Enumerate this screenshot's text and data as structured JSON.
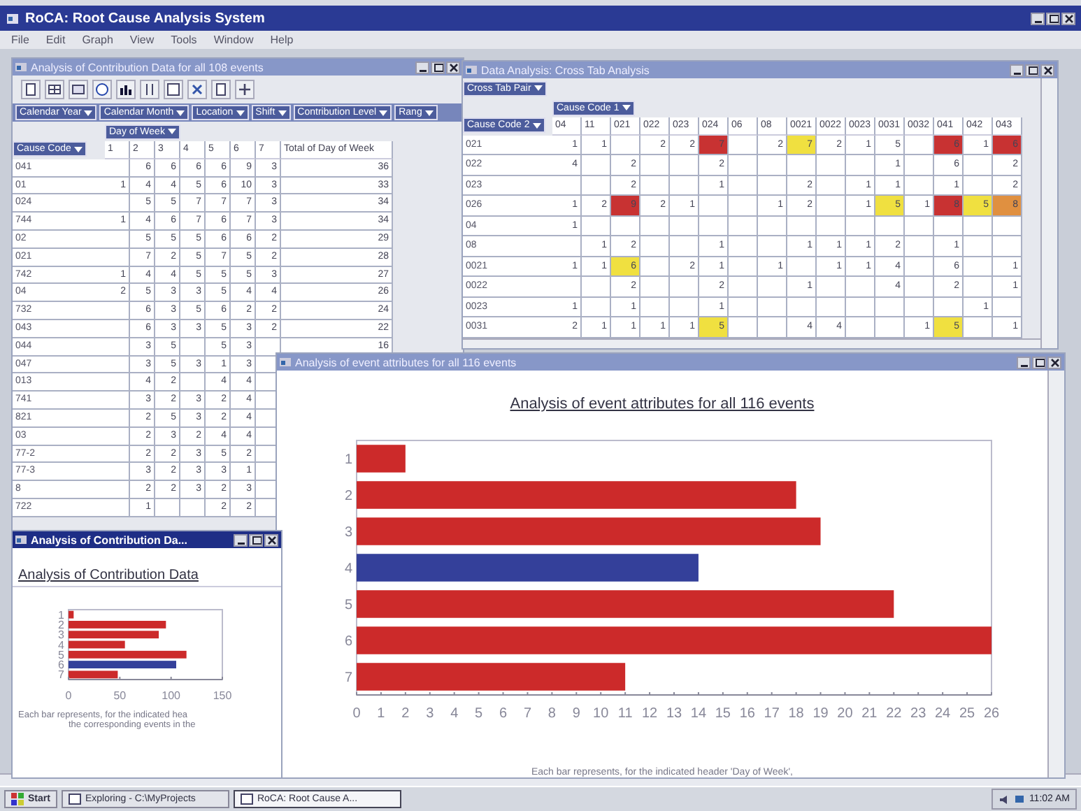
{
  "app": {
    "title": "RoCA: Root Cause Analysis System",
    "menu": [
      "File",
      "Edit",
      "Graph",
      "View",
      "Tools",
      "Window",
      "Help"
    ]
  },
  "pivot_window": {
    "title": "Analysis of Contribution Data for all 108 events",
    "active": false,
    "filters": [
      "Calendar Year",
      "Calendar Month",
      "Location",
      "Shift",
      "Contribution Level",
      "Rang"
    ],
    "column_field": "Day of Week",
    "row_field": "Cause Code",
    "columns": [
      "1",
      "2",
      "3",
      "4",
      "5",
      "6",
      "7",
      "Total of Day of Week"
    ],
    "rows": [
      {
        "label": "041",
        "cells": [
          null,
          "6",
          "6",
          "6",
          "6",
          "9",
          "3",
          "36"
        ]
      },
      {
        "label": "01",
        "cells": [
          "1",
          "4",
          "4",
          "5",
          "6",
          "10",
          "3",
          "33"
        ]
      },
      {
        "label": "024",
        "cells": [
          null,
          "5",
          "5",
          "7",
          "7",
          "7",
          "3",
          "34"
        ]
      },
      {
        "label": "744",
        "cells": [
          "1",
          "4",
          "6",
          "7",
          "6",
          "7",
          "3",
          "34"
        ]
      },
      {
        "label": "02",
        "cells": [
          null,
          "5",
          "5",
          "5",
          "6",
          "6",
          "2",
          "29"
        ]
      },
      {
        "label": "021",
        "cells": [
          null,
          "7",
          "2",
          "5",
          "7",
          "5",
          "2",
          "28"
        ]
      },
      {
        "label": "742",
        "cells": [
          "1",
          "4",
          "4",
          "5",
          "5",
          "5",
          "3",
          "27"
        ]
      },
      {
        "label": "04",
        "cells": [
          "2",
          "5",
          "3",
          "3",
          "5",
          "4",
          "4",
          "26"
        ]
      },
      {
        "label": "732",
        "cells": [
          null,
          "6",
          "3",
          "5",
          "6",
          "2",
          "2",
          "24"
        ]
      },
      {
        "label": "043",
        "cells": [
          null,
          "6",
          "3",
          "3",
          "5",
          "3",
          "2",
          "22"
        ]
      },
      {
        "label": "044",
        "cells": [
          null,
          "3",
          "5",
          null,
          "5",
          "3",
          null,
          "16"
        ]
      },
      {
        "label": "047",
        "cells": [
          null,
          "3",
          "5",
          "3",
          "1",
          "3",
          null
        ]
      },
      {
        "label": "013",
        "cells": [
          null,
          "4",
          "2",
          null,
          "4",
          "4",
          null
        ]
      },
      {
        "label": "741",
        "cells": [
          null,
          "3",
          "2",
          "3",
          "2",
          "4",
          null
        ]
      },
      {
        "label": "821",
        "cells": [
          null,
          "2",
          "5",
          "3",
          "2",
          "4",
          null
        ]
      },
      {
        "label": "03",
        "cells": [
          null,
          "2",
          "3",
          "2",
          "4",
          "4",
          null
        ]
      },
      {
        "label": "77-2",
        "cells": [
          null,
          "2",
          "2",
          "3",
          "5",
          "2",
          null
        ]
      },
      {
        "label": "77-3",
        "cells": [
          null,
          "3",
          "2",
          "3",
          "3",
          "1",
          null
        ]
      },
      {
        "label": "8",
        "cells": [
          null,
          "2",
          "2",
          "3",
          "2",
          "3",
          null
        ]
      },
      {
        "label": "722",
        "cells": [
          null,
          "1",
          null,
          null,
          "2",
          "2",
          null
        ]
      }
    ]
  },
  "crosstab_window": {
    "title": "Data Analysis: Cross Tab Analysis",
    "active": false,
    "page_field": "Cross Tab Pair",
    "column_field": "Cause Code 1",
    "row_field": "Cause Code 2",
    "columns": [
      "04",
      "11",
      "021",
      "022",
      "023",
      "024",
      "06",
      "08",
      "0021",
      "0022",
      "0023",
      "0031",
      "0032",
      "041",
      "042",
      "043"
    ],
    "rows": [
      {
        "label": "021",
        "cells": [
          "1",
          "1",
          null,
          "2",
          "2",
          {
            "value": "7",
            "color": "#c83232"
          },
          null,
          "2",
          {
            "value": "7",
            "color": "#f0e040"
          },
          "2",
          "1",
          "5",
          null,
          {
            "value": "6",
            "color": "#c83232"
          },
          "1",
          {
            "value": "6",
            "color": "#c83232"
          }
        ]
      },
      {
        "label": "022",
        "cells": [
          "4",
          null,
          "2",
          null,
          null,
          "2",
          null,
          null,
          null,
          null,
          null,
          "1",
          null,
          "6",
          null,
          "2"
        ]
      },
      {
        "label": "023",
        "cells": [
          null,
          null,
          "2",
          null,
          null,
          "1",
          null,
          null,
          "2",
          null,
          "1",
          "1",
          null,
          "1",
          null,
          "2"
        ]
      },
      {
        "label": "026",
        "cells": [
          "1",
          "2",
          {
            "value": "9",
            "color": "#c83232"
          },
          "2",
          "1",
          null,
          null,
          "1",
          "2",
          null,
          "1",
          {
            "value": "5",
            "color": "#f0e040"
          },
          "1",
          {
            "value": "8",
            "color": "#c83232"
          },
          {
            "value": "5",
            "color": "#f0e040"
          },
          {
            "value": "8",
            "color": "#e09040"
          }
        ]
      },
      {
        "label": "04",
        "cells": [
          "1",
          null,
          null,
          null,
          null,
          null,
          null,
          null,
          null,
          null,
          null,
          null,
          null,
          null,
          null,
          null
        ]
      },
      {
        "label": "08",
        "cells": [
          null,
          "1",
          "2",
          null,
          null,
          "1",
          null,
          null,
          "1",
          "1",
          "1",
          "2",
          null,
          "1",
          null,
          null
        ]
      },
      {
        "label": "0021",
        "cells": [
          "1",
          "1",
          {
            "value": "6",
            "color": "#f0e040"
          },
          null,
          "2",
          "1",
          null,
          "1",
          null,
          "1",
          "1",
          "4",
          null,
          "6",
          null,
          "1"
        ]
      },
      {
        "label": "0022",
        "cells": [
          null,
          null,
          "2",
          null,
          null,
          "2",
          null,
          null,
          "1",
          null,
          null,
          "4",
          null,
          "2",
          null,
          "1"
        ]
      },
      {
        "label": "0023",
        "cells": [
          "1",
          null,
          "1",
          null,
          null,
          "1",
          null,
          null,
          null,
          null,
          null,
          null,
          null,
          null,
          "1",
          null
        ]
      },
      {
        "label": "0031",
        "cells": [
          "2",
          "1",
          "1",
          "1",
          "1",
          {
            "value": "5",
            "color": "#f0e040"
          },
          null,
          null,
          "4",
          "4",
          null,
          null,
          "1",
          {
            "value": "5",
            "color": "#f0e040"
          },
          null,
          "1"
        ]
      }
    ]
  },
  "event_chart_window": {
    "title": "Analysis of event attributes for all 116 events",
    "active": false,
    "caption": "Each bar represents, for the indicated header 'Day of Week',",
    "chart_data": {
      "type": "bar",
      "orientation": "horizontal",
      "stacked": true,
      "title": "Analysis of event attributes for all 116 events",
      "categories": [
        "1",
        "2",
        "3",
        "4",
        "5",
        "6",
        "7"
      ],
      "series": [
        {
          "color": "#cc2a2a",
          "values": [
            2,
            18,
            19,
            null,
            22,
            26,
            11
          ]
        },
        {
          "color": "#34409a",
          "values": [
            null,
            null,
            null,
            14,
            null,
            null,
            null
          ]
        }
      ],
      "xlim": [
        0,
        26
      ],
      "xticks": [
        0,
        1,
        2,
        3,
        4,
        5,
        6,
        7,
        8,
        9,
        10,
        11,
        12,
        13,
        14,
        15,
        16,
        17,
        18,
        19,
        20,
        21,
        22,
        23,
        24,
        25,
        26
      ]
    }
  },
  "contribution_chart_window": {
    "title": "Analysis of Contribution Da...",
    "active": true,
    "caption": [
      "Each bar represents, for the indicated hea",
      "the corresponding events in the"
    ],
    "chart_data": {
      "type": "bar",
      "orientation": "horizontal",
      "stacked": true,
      "title": "Analysis of Contribution Data",
      "categories": [
        "1",
        "2",
        "3",
        "4",
        "5",
        "6",
        "7"
      ],
      "series": [
        {
          "color": "#cc2a2a",
          "values": [
            5,
            95,
            88,
            55,
            115,
            null,
            48
          ]
        },
        {
          "color": "#34409a",
          "values": [
            null,
            null,
            null,
            null,
            null,
            105,
            null
          ]
        }
      ],
      "xlim": [
        0,
        150
      ],
      "xticks": [
        0,
        50,
        100,
        150
      ]
    }
  },
  "taskbar": {
    "start": "Start",
    "tasks": [
      {
        "label": "Exploring - C:\\MyProjects",
        "selected": false
      },
      {
        "label": "RoCA: Root Cause A...",
        "selected": true
      }
    ],
    "clock": "11:02 AM"
  }
}
